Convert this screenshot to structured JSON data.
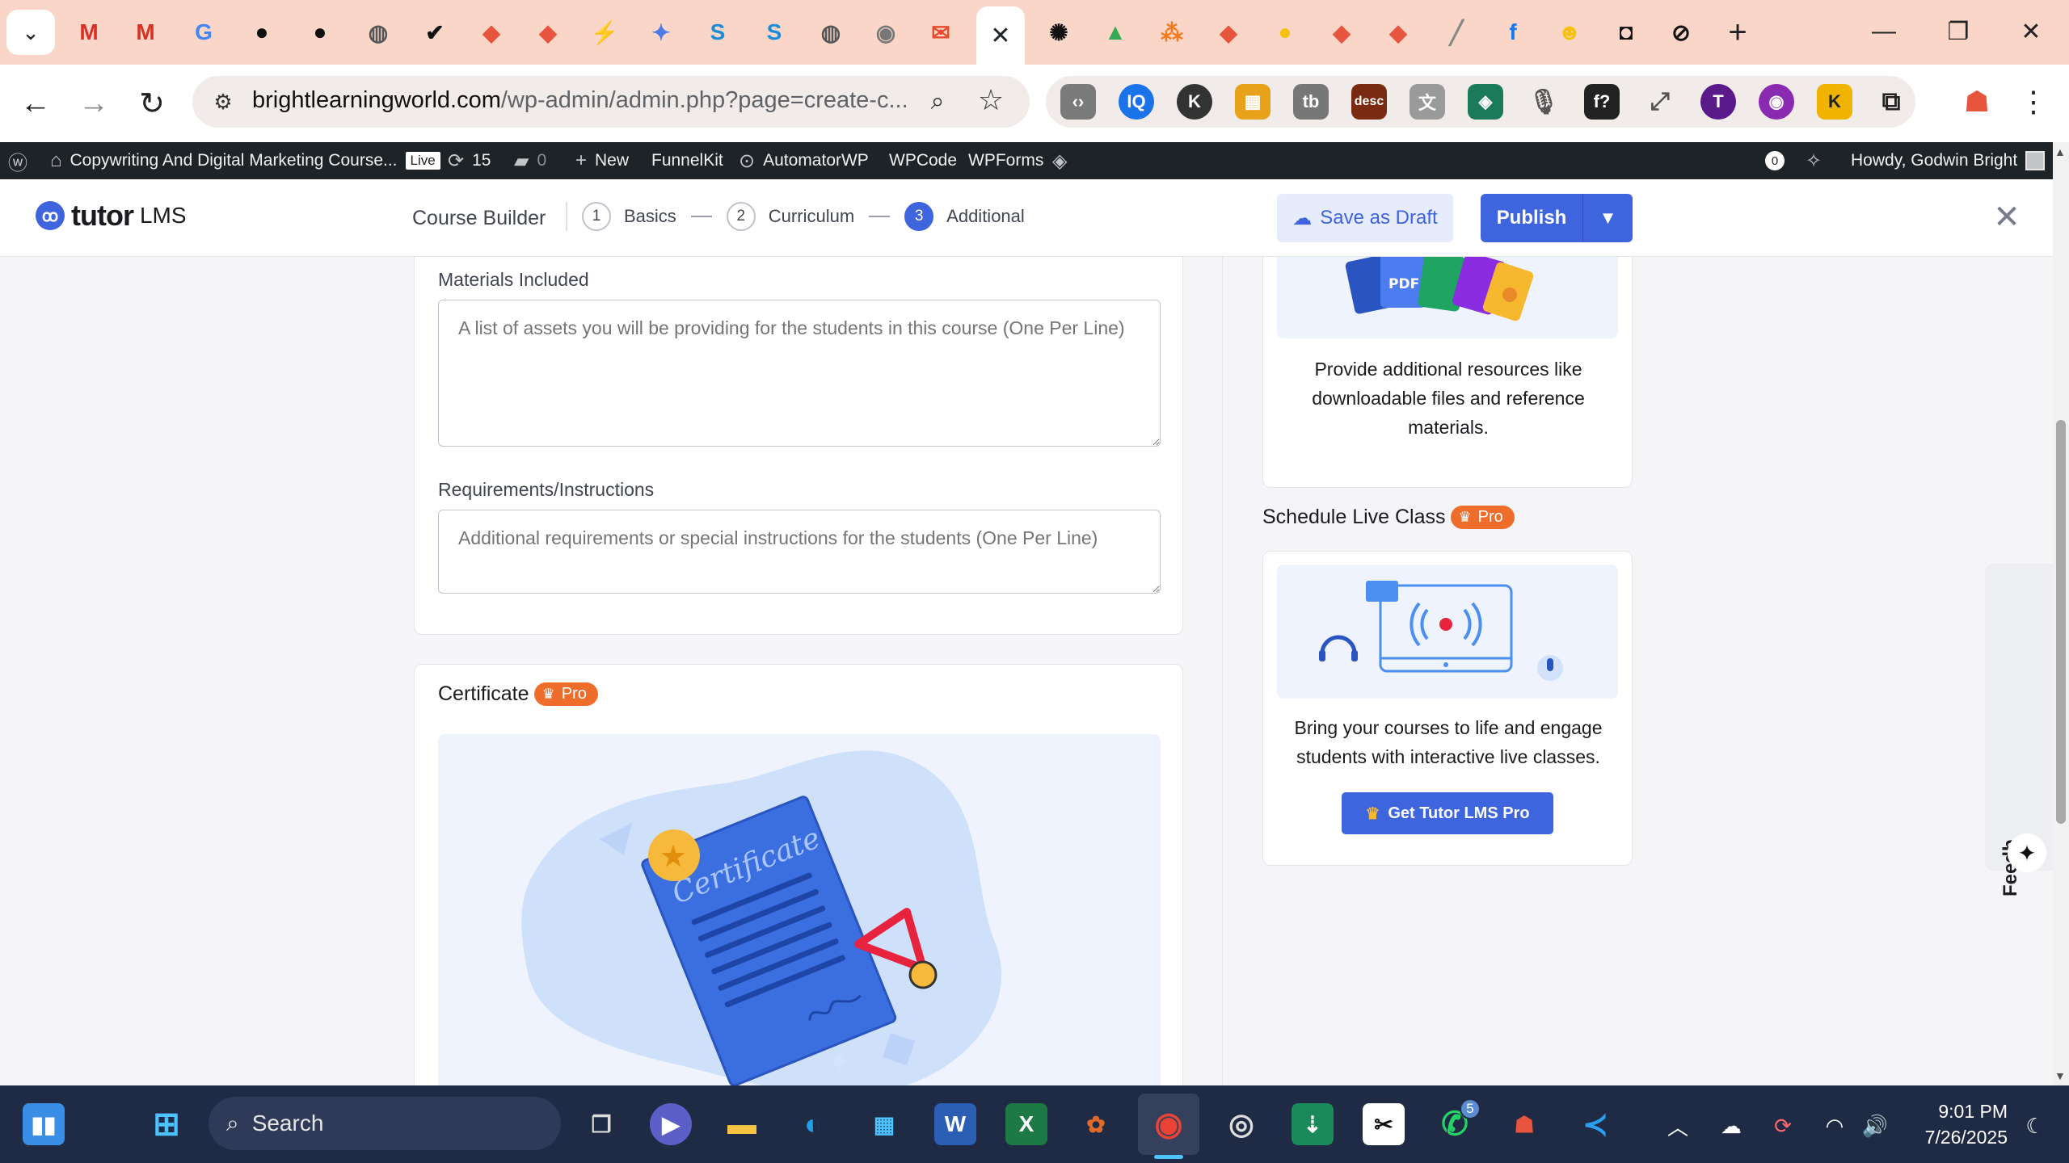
{
  "browser": {
    "active_tab_close": "✕",
    "new_tab": "+",
    "url_domain": "brightlearningworld.com",
    "url_path": "/wp-admin/admin.php?page=create-c...",
    "window_controls": [
      "—",
      "❐",
      "✕"
    ]
  },
  "wp_admin_bar": {
    "site_name": "Copywriting And Digital Marketing Course...",
    "live_label": "Live",
    "updates_count": "15",
    "comments_count": "0",
    "new_label": "New",
    "items": [
      "FunnelKit",
      "AutomatorWP",
      "WPCode",
      "WPForms"
    ],
    "notifications_count": "0",
    "howdy": "Howdy, Godwin Bright"
  },
  "tutor_header": {
    "logo_word1": "tutor",
    "logo_word2": "LMS",
    "builder_title": "Course Builder",
    "steps": [
      {
        "num": "1",
        "label": "Basics"
      },
      {
        "num": "2",
        "label": "Curriculum"
      },
      {
        "num": "3",
        "label": "Additional"
      }
    ],
    "save_draft": "Save as Draft",
    "publish": "Publish"
  },
  "main": {
    "materials_label": "Materials Included",
    "materials_placeholder": "A list of assets you will be providing for the students in this course (One Per Line)",
    "requirements_label": "Requirements/Instructions",
    "requirements_placeholder": "Additional requirements or special instructions for the students (One Per Line)",
    "certificate_title": "Certificate",
    "pro_label": "Pro",
    "certificate_word": "Certificate"
  },
  "sidebar": {
    "resources_text": "Provide additional resources like downloadable files and reference materials.",
    "pdf_label": "PDF",
    "live_class_title": "Schedule Live Class",
    "live_class_text": "Bring your courses to life and engage students with interactive live classes.",
    "get_pro": "Get Tutor LMS Pro",
    "feedback_label": "Feedback"
  },
  "taskbar": {
    "search_label": "Search",
    "whatsapp_badge": "5",
    "time": "9:01 PM",
    "date": "7/26/2025"
  },
  "colors": {
    "tutor_blue": "#3e64de",
    "pro_orange": "#ee6d2a",
    "wp_bar": "#1d2327",
    "tab_strip": "#f9d6c8",
    "taskbar": "#1f2a44"
  }
}
